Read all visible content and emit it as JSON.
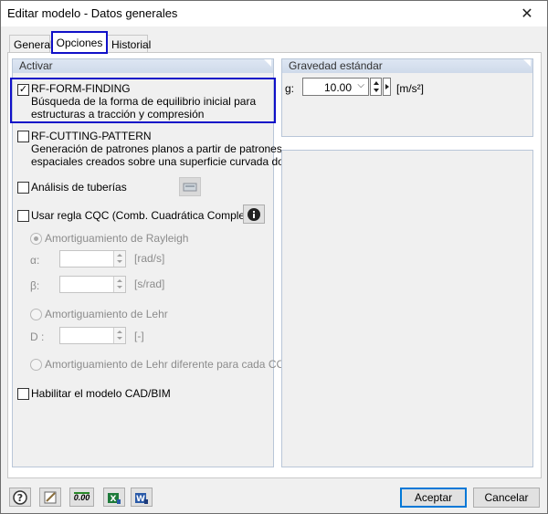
{
  "window": {
    "title": "Editar modelo - Datos generales",
    "close_glyph": "✕"
  },
  "tabs": [
    {
      "label": "General"
    },
    {
      "label": "Opciones"
    },
    {
      "label": "Historial"
    }
  ],
  "activar": {
    "header": "Activar",
    "form_finding": {
      "label": "RF-FORM-FINDING",
      "checked": true,
      "desc1": "Búsqueda de la forma de equilibrio inicial para",
      "desc2": "estructuras a tracción y compresión"
    },
    "cutting_pattern": {
      "label": "RF-CUTTING-PATTERN",
      "checked": false,
      "desc1": "Generación de patrones planos a partir de patrones",
      "desc2": "espaciales creados sobre una superficie curvada doble"
    },
    "tuberias": {
      "label": "Análisis de tuberías",
      "checked": false,
      "icon": "pipe-settings-icon"
    },
    "cqc": {
      "label": "Usar regla CQC (Comb. Cuadrática Completa)",
      "checked": false,
      "icon": "info-icon"
    },
    "rayleigh": {
      "label": "Amortiguamiento de Rayleigh",
      "alpha_label": "α:",
      "alpha_unit": "[rad/s]",
      "beta_label": "β:",
      "beta_unit": "[s/rad]"
    },
    "lehr": {
      "label": "Amortiguamiento de Lehr",
      "d_label": "D :",
      "d_unit": "[-]"
    },
    "lehr_cc": {
      "label": "Amortiguamiento de Lehr diferente para cada CC"
    },
    "cad_bim": {
      "label": "Habilitar el modelo CAD/BIM",
      "checked": false
    }
  },
  "gravedad": {
    "header": "Gravedad estándar",
    "g_label": "g:",
    "g_value": "10.00",
    "g_unit": "[m/s²]"
  },
  "footer": {
    "icons": [
      "help-icon",
      "edit-icon",
      "units-icon",
      "excel-export-icon",
      "word-export-icon"
    ],
    "units_text": "0.00",
    "accept": "Aceptar",
    "cancel": "Cancelar"
  }
}
